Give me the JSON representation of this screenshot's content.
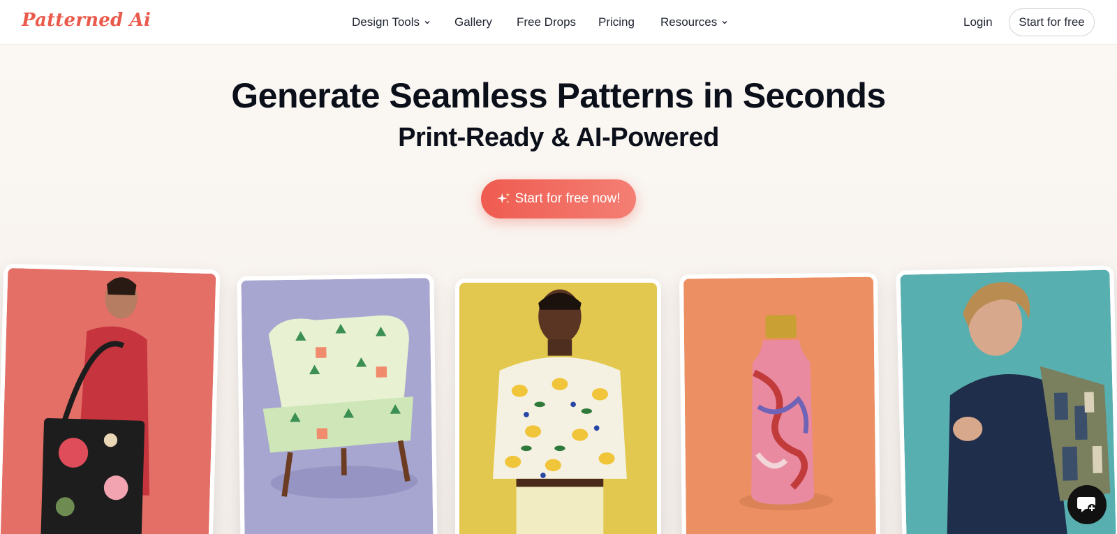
{
  "brand": {
    "logo_text": "Patterned Ai",
    "accent": "#ea5a4c"
  },
  "nav": {
    "items": [
      {
        "label": "Design Tools",
        "dropdown": true
      },
      {
        "label": "Gallery",
        "dropdown": false
      },
      {
        "label": "Free Drops",
        "dropdown": false
      },
      {
        "label": "Pricing",
        "dropdown": false
      },
      {
        "label": "Resources",
        "dropdown": true
      }
    ],
    "login_label": "Login",
    "start_label": "Start for free"
  },
  "hero": {
    "title": "Generate Seamless Patterns in Seconds",
    "subtitle": "Print-Ready & AI-Powered",
    "cta_label": "Start for free now!",
    "cta_icon": "sparkle-icon"
  },
  "showcase": {
    "cards": [
      {
        "name": "woman-with-floral-tote",
        "bg": "#e8776f"
      },
      {
        "name": "palm-print-armchair",
        "bg": "#a7a6d0"
      },
      {
        "name": "man-in-lemon-shirt",
        "bg": "#e3c84f"
      },
      {
        "name": "marbled-water-bottle",
        "bg": "#ee9a6a"
      },
      {
        "name": "teen-with-patterned-backpack",
        "bg": "#5fb3b3"
      }
    ]
  },
  "chat": {
    "icon": "chat-bubble-icon"
  }
}
